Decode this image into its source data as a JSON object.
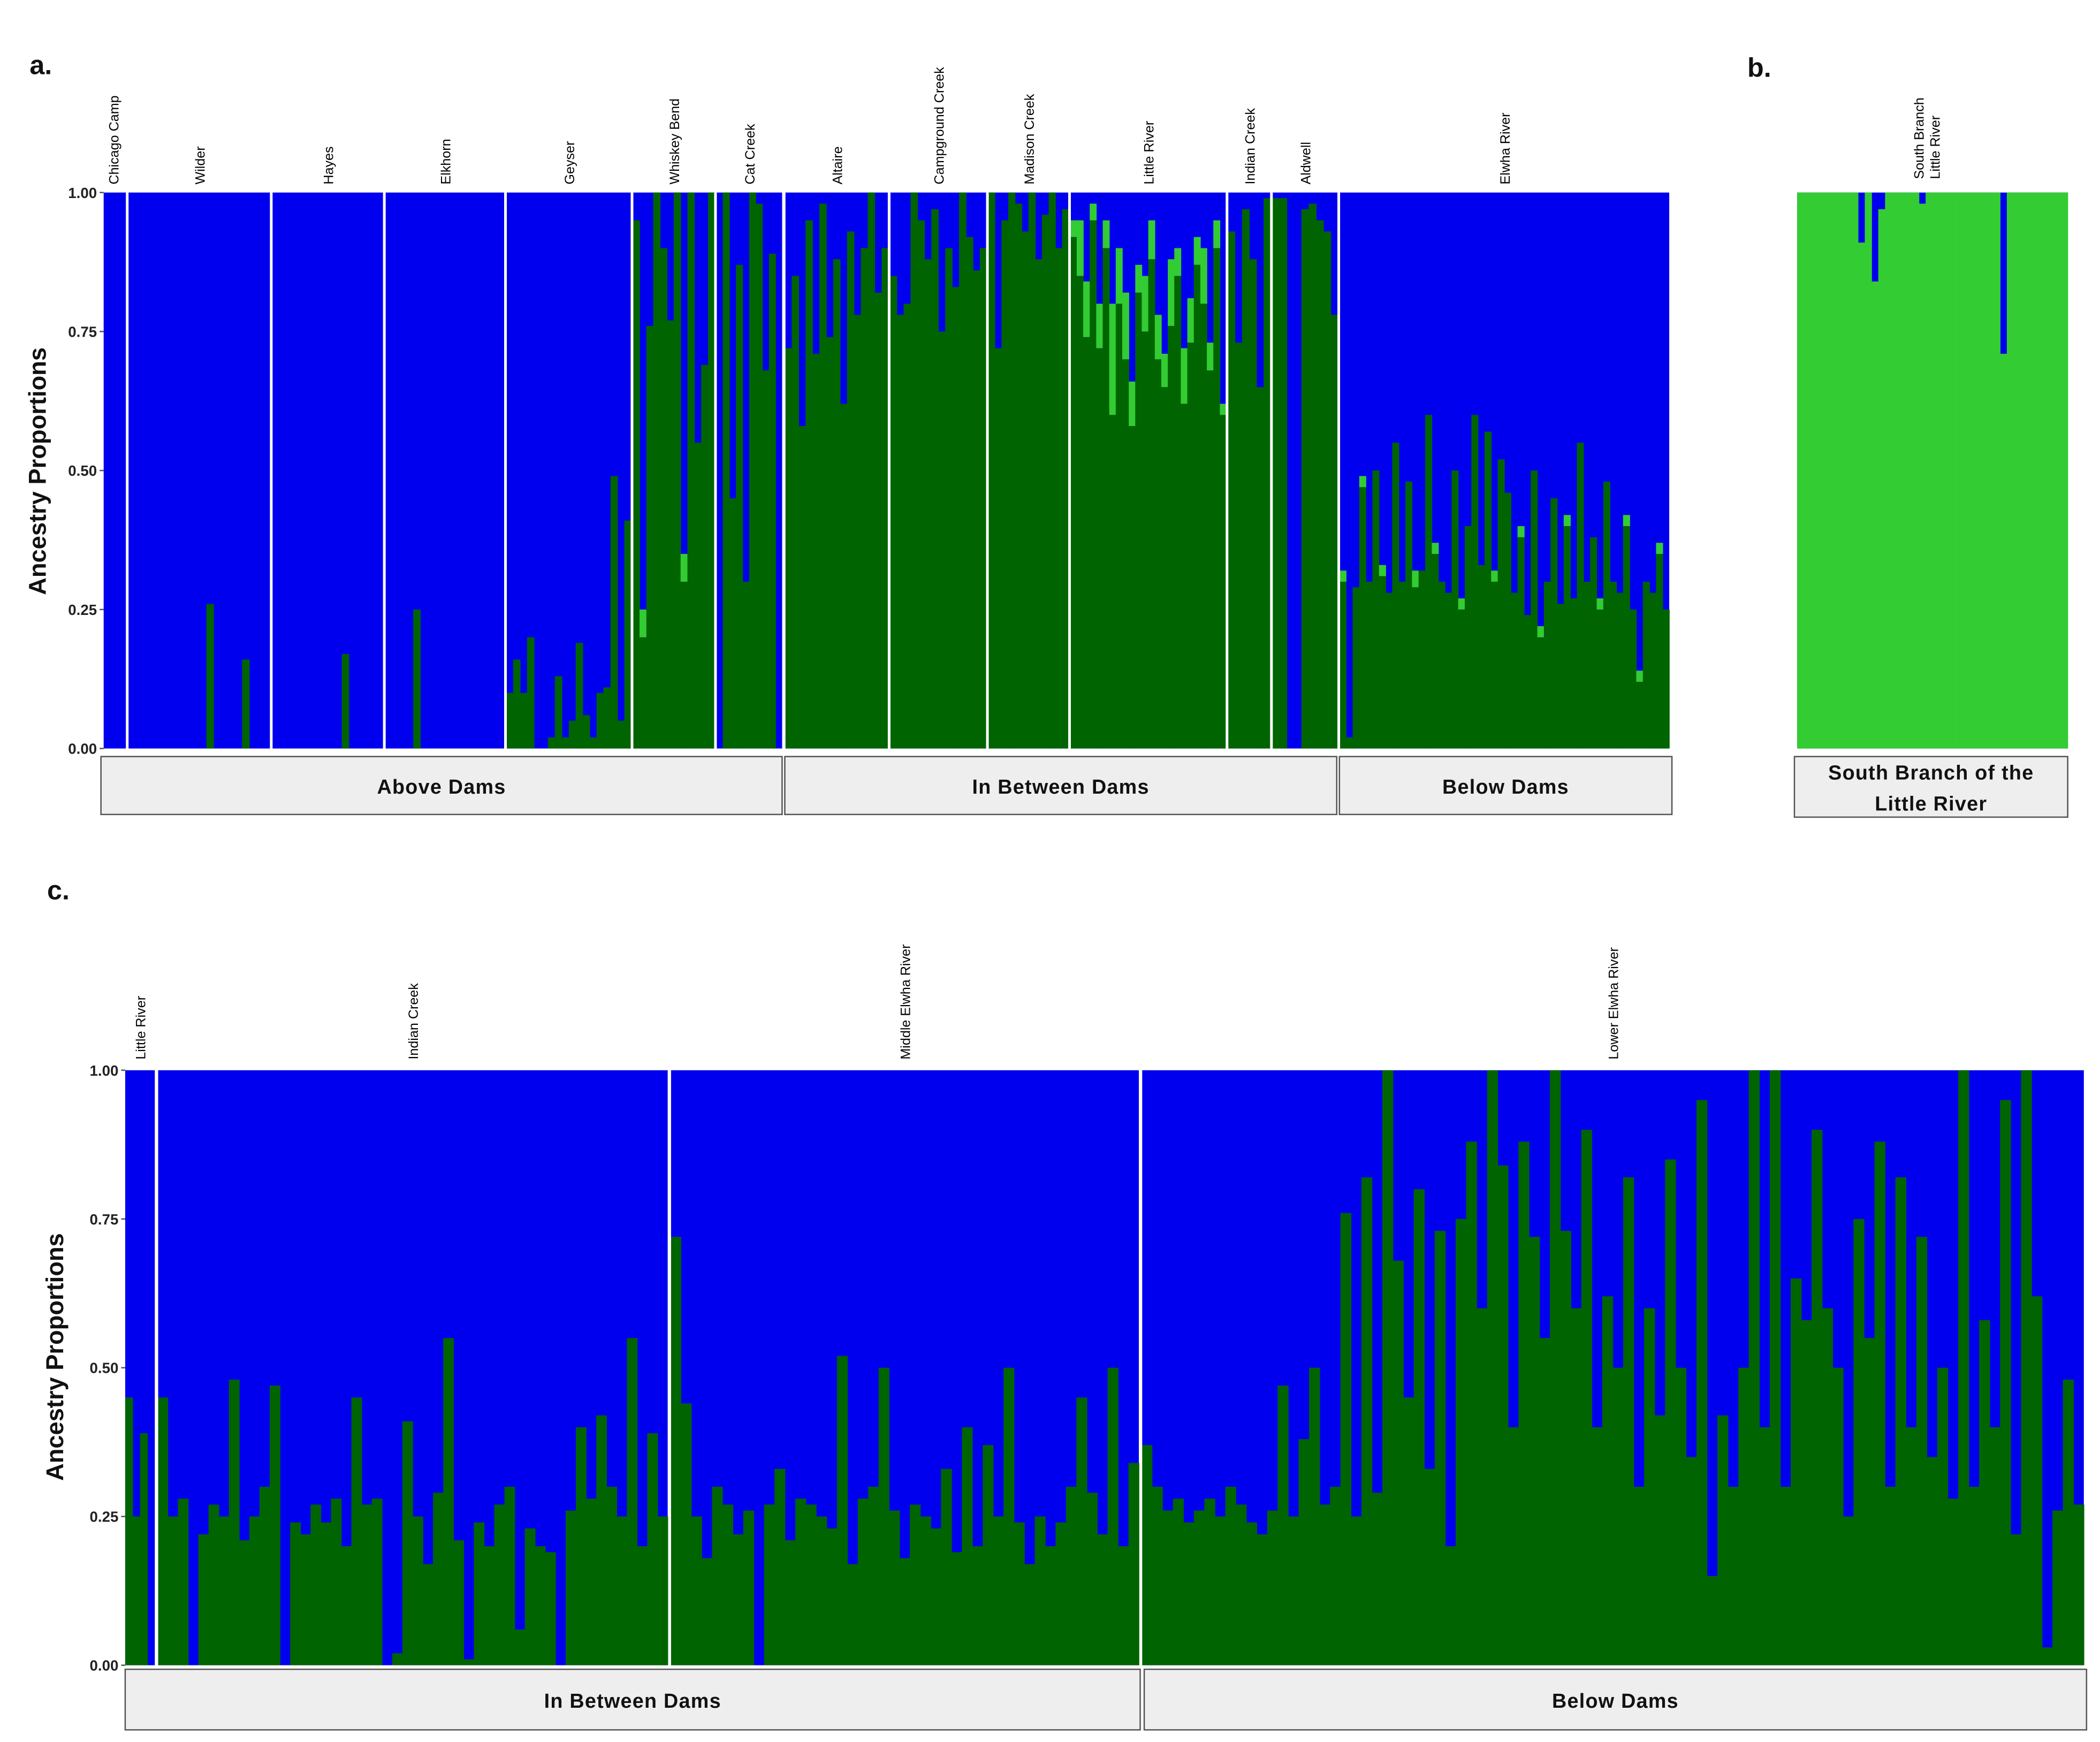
{
  "colors": {
    "blue": "#0000EE",
    "dark_green": "#006400",
    "light_green": "#33CC33",
    "box_fill": "#EEEEEE"
  },
  "chart_data": [
    {
      "panel": "a.",
      "type": "bar",
      "stacked": true,
      "ylabel": "Ancestry Proportions",
      "ylim": [
        0,
        1
      ],
      "yticks": [
        "0.00",
        "0.25",
        "0.50",
        "0.75",
        "1.00"
      ],
      "components": [
        "dark_green",
        "light_green",
        "blue"
      ],
      "groups": [
        {
          "label": "Above Dams",
          "populations": [
            0,
            1,
            2,
            3,
            4,
            5,
            6
          ]
        },
        {
          "label": "In Between Dams",
          "populations": [
            7,
            8,
            9,
            10,
            11,
            12
          ]
        },
        {
          "label": "Below Dams",
          "populations": [
            13
          ]
        }
      ],
      "populations": [
        {
          "name": "Chicago Camp",
          "dark": [
            0,
            0,
            0,
            0,
            0,
            0
          ]
        },
        {
          "name": "Wilder",
          "dark": [
            0,
            0,
            0,
            0,
            0,
            0,
            0,
            0,
            0,
            0,
            0,
            0.26,
            0,
            0,
            0,
            0,
            0.16,
            0,
            0,
            0
          ]
        },
        {
          "name": "Hayes",
          "dark": [
            0,
            0,
            0,
            0,
            0,
            0,
            0,
            0,
            0,
            0,
            0.17,
            0,
            0,
            0,
            0,
            0
          ]
        },
        {
          "name": "Elkhorn",
          "dark": [
            0,
            0,
            0,
            0,
            0.25,
            0,
            0,
            0,
            0,
            0,
            0,
            0,
            0,
            0,
            0,
            0,
            0
          ]
        },
        {
          "name": "Geyser",
          "dark": [
            0.1,
            0.16,
            0.1,
            0.2,
            0,
            0,
            0.02,
            0.13,
            0.02,
            0.05,
            0.19,
            0.06,
            0.02,
            0.1,
            0.11,
            0.49,
            0.05,
            0.41
          ]
        },
        {
          "name": "Whiskey Bend",
          "dark": [
            0.95,
            0.2,
            0.76,
            1,
            0.9,
            0.77,
            1,
            0.3,
            1,
            0.55,
            0.69,
            1
          ],
          "light": [
            0,
            0.05,
            0,
            0,
            0,
            0,
            0,
            0.05,
            0,
            0,
            0,
            0
          ]
        },
        {
          "name": "Cat Creek",
          "dark": [
            0,
            1,
            0.45,
            0.87,
            0.3,
            1,
            0.98,
            0.68,
            0.89,
            0
          ]
        },
        {
          "name": "Altaire",
          "dark": [
            0.72,
            0.85,
            0.58,
            0.95,
            0.71,
            0.98,
            0.74,
            0.88,
            0.62,
            0.93,
            0.78,
            0.9,
            1,
            0.82,
            0.9
          ]
        },
        {
          "name": "Campground Creek",
          "dark": [
            0.85,
            0.78,
            0.8,
            1,
            0.95,
            0.88,
            0.97,
            0.75,
            0.9,
            0.83,
            1,
            0.92,
            0.86,
            0.9
          ]
        },
        {
          "name": "Madison Creek",
          "dark": [
            1,
            0.72,
            0.95,
            1,
            0.98,
            0.93,
            1,
            0.88,
            0.96,
            1,
            0.9,
            0.97
          ]
        },
        {
          "name": "Little  River",
          "dark": [
            0.92,
            0.85,
            0.74,
            0.95,
            0.72,
            0.9,
            0.6,
            0.8,
            0.7,
            0.58,
            0.82,
            0.75,
            0.88,
            0.7,
            0.65,
            0.76,
            0.85,
            0.62,
            0.73,
            0.87,
            0.8,
            0.68,
            0.9,
            0.6
          ],
          "light": [
            0.03,
            0.1,
            0.1,
            0.03,
            0.08,
            0.05,
            0.2,
            0.1,
            0.12,
            0.08,
            0.05,
            0.1,
            0.07,
            0.08,
            0.06,
            0.12,
            0.05,
            0.1,
            0.08,
            0.05,
            0.1,
            0.05,
            0.05,
            0.02
          ]
        },
        {
          "name": "Indian Creek",
          "dark": [
            0.93,
            0.73,
            0.97,
            0.88,
            0.65,
            0.99
          ]
        },
        {
          "name": "Aldwell",
          "dark": [
            0.99,
            0.99,
            0,
            0,
            0.97,
            0.98,
            0.95,
            0.93,
            0.78
          ]
        },
        {
          "name": "Elwha River",
          "dark": [
            0.3,
            0.02,
            0.29,
            0.47,
            0.3,
            0.5,
            0.31,
            0.28,
            0.55,
            0.3,
            0.48,
            0.29,
            0.32,
            0.6,
            0.35,
            0.3,
            0.28,
            0.5,
            0.25,
            0.4,
            0.6,
            0.33,
            0.57,
            0.3,
            0.52,
            0.46,
            0.28,
            0.38,
            0.24,
            0.5,
            0.2,
            0.3,
            0.45,
            0.26,
            0.4,
            0.27,
            0.55,
            0.3,
            0.38,
            0.25,
            0.48,
            0.3,
            0.28,
            0.4,
            0.25,
            0.12,
            0.3,
            0.28,
            0.35,
            0.25
          ],
          "light": [
            0.02,
            0,
            0,
            0.02,
            0,
            0,
            0.02,
            0,
            0,
            0,
            0,
            0.03,
            0,
            0,
            0.02,
            0,
            0,
            0,
            0.02,
            0,
            0,
            0,
            0,
            0.02,
            0,
            0,
            0,
            0.02,
            0,
            0,
            0.02,
            0,
            0,
            0,
            0.02,
            0,
            0,
            0,
            0,
            0.02,
            0,
            0,
            0,
            0.02,
            0,
            0.02,
            0,
            0,
            0.02,
            0
          ]
        }
      ]
    },
    {
      "panel": "b.",
      "type": "bar",
      "stacked": true,
      "ylim": [
        0,
        1
      ],
      "group_label": "South Branch of the Little River",
      "population_label_lines": [
        "South Branch",
        "Little River"
      ],
      "populations": [
        {
          "name": "South Branch Little River",
          "dark": [
            0,
            0,
            0,
            0,
            0,
            0,
            0,
            0,
            0,
            0,
            0,
            0,
            0,
            0,
            0,
            0,
            0,
            0,
            0,
            0,
            0,
            0,
            0,
            0,
            0,
            0,
            0,
            0,
            0,
            0,
            0,
            0,
            0,
            0,
            0,
            0,
            0,
            0,
            0,
            0
          ],
          "light": [
            1,
            1,
            1,
            1,
            1,
            1,
            1,
            1,
            1,
            0.91,
            1,
            0.84,
            0.97,
            1,
            1,
            1,
            1,
            1,
            0.98,
            1,
            1,
            1,
            1,
            1,
            1,
            1,
            1,
            1,
            1,
            1,
            0.71,
            1,
            1,
            1,
            1,
            1,
            1,
            1,
            1,
            1
          ]
        }
      ]
    },
    {
      "panel": "c.",
      "type": "bar",
      "stacked": true,
      "ylabel": "Ancestry Proportions",
      "ylim": [
        0,
        1
      ],
      "yticks": [
        "0.00",
        "0.25",
        "0.50",
        "0.75",
        "1.00"
      ],
      "groups": [
        {
          "label": "In Between Dams",
          "populations": [
            0,
            1,
            2
          ]
        },
        {
          "label": "Below Dams",
          "populations": [
            3
          ]
        }
      ],
      "populations": [
        {
          "name": "Little  River",
          "dark": [
            0.45,
            0.25,
            0.39,
            0
          ]
        },
        {
          "name": "Indian Creek",
          "dark": [
            0.45,
            0.25,
            0.28,
            0,
            0.22,
            0.27,
            0.25,
            0.48,
            0.21,
            0.25,
            0.3,
            0.47,
            0,
            0.24,
            0.22,
            0.27,
            0.24,
            0.28,
            0.2,
            0.45,
            0.27,
            0.28,
            0,
            0.02,
            0.41,
            0.25,
            0.17,
            0.29,
            0.55,
            0.21,
            0.01,
            0.24,
            0.2,
            0.27,
            0.3,
            0.06,
            0.23,
            0.2,
            0.19,
            0,
            0.26,
            0.4,
            0.28,
            0.42,
            0.3,
            0.25,
            0.55,
            0.2,
            0.39,
            0.25
          ]
        },
        {
          "name": "Middle Elwha River",
          "dark": [
            0.72,
            0.44,
            0.25,
            0.18,
            0.3,
            0.27,
            0.22,
            0.26,
            0,
            0.27,
            0.33,
            0.21,
            0.28,
            0.27,
            0.25,
            0.23,
            0.52,
            0.17,
            0.28,
            0.3,
            0.5,
            0.26,
            0.18,
            0.27,
            0.25,
            0.23,
            0.33,
            0.19,
            0.4,
            0.2,
            0.37,
            0.25,
            0.5,
            0.24,
            0.17,
            0.25,
            0.2,
            0.24,
            0.3,
            0.45,
            0.29,
            0.22,
            0.5,
            0.2,
            0.34
          ]
        },
        {
          "name": "Lower Elwha River",
          "dark": [
            0.37,
            0.3,
            0.26,
            0.28,
            0.24,
            0.26,
            0.28,
            0.25,
            0.3,
            0.27,
            0.24,
            0.22,
            0.26,
            0.47,
            0.25,
            0.38,
            0.5,
            0.27,
            0.3,
            0.76,
            0.25,
            0.82,
            0.29,
            1,
            0.68,
            0.45,
            0.8,
            0.33,
            0.73,
            0.2,
            0.75,
            0.88,
            0.6,
            1,
            0.84,
            0.4,
            0.88,
            0.72,
            0.55,
            1,
            0.73,
            0.6,
            0.9,
            0.4,
            0.62,
            0.5,
            0.82,
            0.3,
            0.6,
            0.42,
            0.85,
            0.5,
            0.35,
            0.95,
            0.15,
            0.42,
            0.3,
            0.5,
            1,
            0.4,
            1,
            0.3,
            0.65,
            0.58,
            0.9,
            0.6,
            0.5,
            0.25,
            0.75,
            0.55,
            0.88,
            0.3,
            0.82,
            0.4,
            0.72,
            0.35,
            0.5,
            0.28,
            1,
            0.3,
            0.58,
            0.4,
            0.95,
            0.22,
            1,
            0.62,
            0.03,
            0.26,
            0.48,
            0.27
          ]
        }
      ]
    }
  ]
}
